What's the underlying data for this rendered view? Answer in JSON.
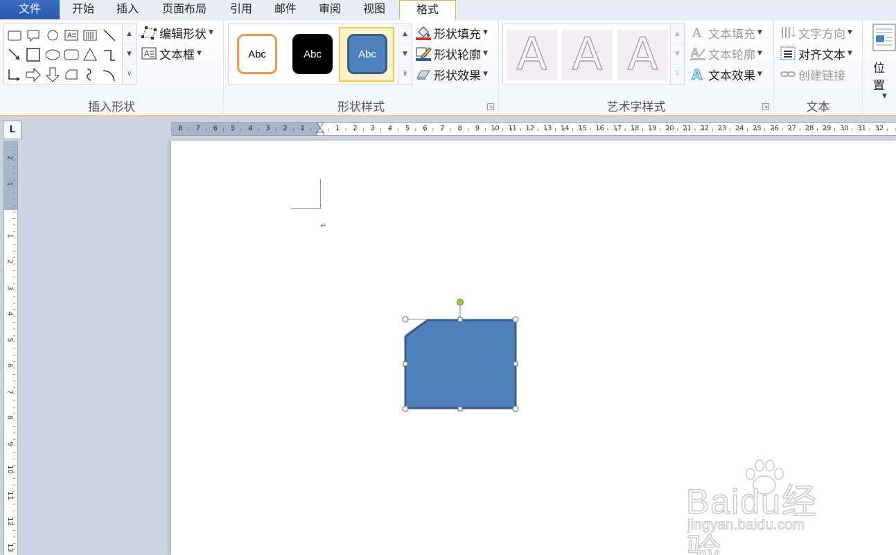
{
  "tabs": {
    "file": "文件",
    "home": "开始",
    "insert": "插入",
    "page_layout": "页面布局",
    "references": "引用",
    "mailings": "邮件",
    "review": "审阅",
    "view": "视图",
    "format": "格式"
  },
  "ribbon": {
    "insert_shapes": {
      "label": "插入形状",
      "edit_shape": "编辑形状",
      "text_box": "文本框"
    },
    "shape_styles": {
      "label": "形状样式",
      "swatch_text": "Abc",
      "fill": "形状填充",
      "outline": "形状轮廓",
      "effects": "形状效果",
      "swatch_colors": [
        "#f79646",
        "#000000",
        "#4f81bd"
      ]
    },
    "wordart_styles": {
      "label": "艺术字样式",
      "letter": "A",
      "text_fill": "文本填充",
      "text_outline": "文本轮廓",
      "text_effects": "文本效果"
    },
    "text": {
      "label": "文本",
      "text_direction": "文字方向",
      "align_text": "对齐文本",
      "create_link": "创建链接"
    },
    "arrange": {
      "position": "位置"
    }
  },
  "ruler": {
    "corner": "L",
    "h_left_numbers": [
      "8",
      "7",
      "6",
      "5",
      "4",
      "3",
      "2",
      "1"
    ],
    "h_numbers": [
      "1",
      "2",
      "3",
      "4",
      "5",
      "6",
      "7",
      "8",
      "9",
      "10",
      "11",
      "12",
      "13",
      "14",
      "15",
      "16",
      "17",
      "18",
      "19",
      "20",
      "21",
      "22",
      "23",
      "24",
      "25",
      "26",
      "27",
      "28",
      "29",
      "30",
      "31",
      "32"
    ],
    "v_top_numbers": [
      "2",
      "1"
    ],
    "v_numbers": [
      "1",
      "2",
      "3",
      "4",
      "5",
      "6",
      "7",
      "8",
      "9",
      "10",
      "11",
      "12",
      "13"
    ]
  },
  "document": {
    "paragraph_mark": "↵",
    "shape_fill": "#4f81bd",
    "shape_outline": "#385d8a"
  },
  "watermark": {
    "logo": "Baidu经验",
    "url": "jingyan.baidu.com"
  }
}
